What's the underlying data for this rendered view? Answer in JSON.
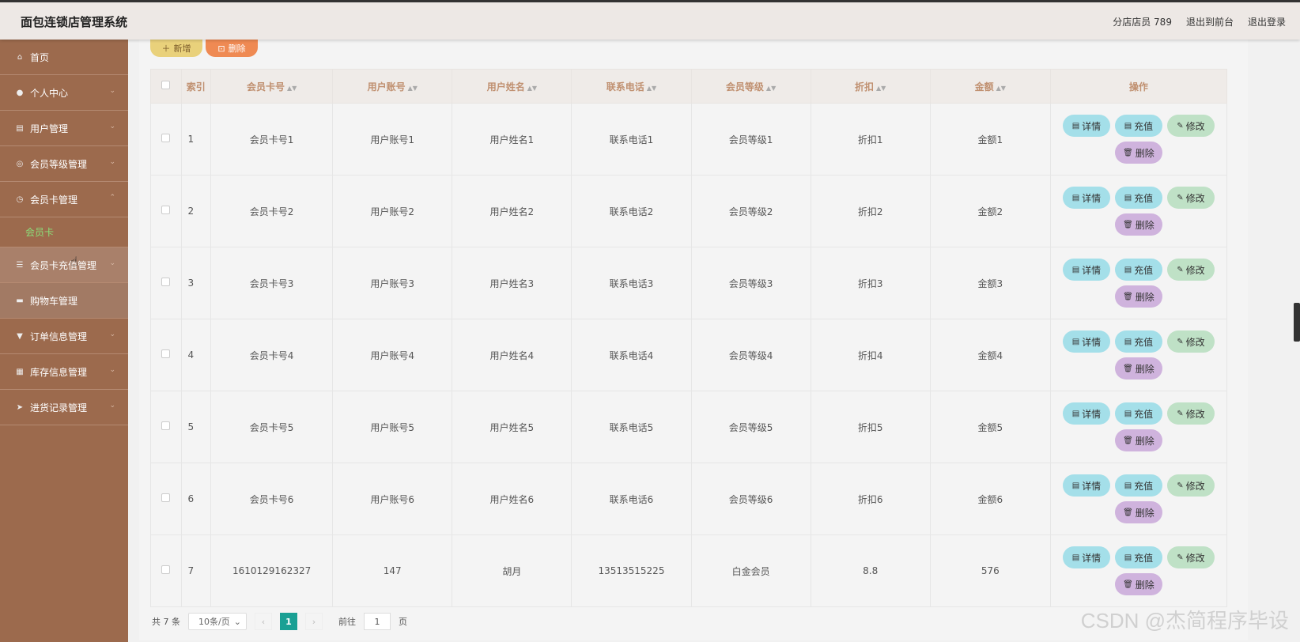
{
  "header": {
    "title": "面包连锁店管理系统",
    "user": "分店店员 789",
    "to_front": "退出到前台",
    "logout": "退出登录"
  },
  "sidebar": {
    "items": [
      {
        "label": "首页",
        "icon": "home-icon"
      },
      {
        "label": "个人中心",
        "icon": "user-icon"
      },
      {
        "label": "用户管理",
        "icon": "clipboard-icon"
      },
      {
        "label": "会员等级管理",
        "icon": "compass-icon"
      },
      {
        "label": "会员卡管理",
        "icon": "clock-icon"
      },
      {
        "label": "会员卡",
        "icon": ""
      },
      {
        "label": "会员卡充值管理",
        "icon": "list-icon"
      },
      {
        "label": "购物车管理",
        "icon": "cart-icon"
      },
      {
        "label": "订单信息管理",
        "icon": "filter-icon"
      },
      {
        "label": "库存信息管理",
        "icon": "printer-icon"
      },
      {
        "label": "进货记录管理",
        "icon": "send-icon"
      }
    ]
  },
  "toolbar": {
    "add_label": "新增",
    "delete_label": "删除"
  },
  "table": {
    "headers": [
      "索引",
      "会员卡号",
      "用户账号",
      "用户姓名",
      "联系电话",
      "会员等级",
      "折扣",
      "金额",
      "操作"
    ],
    "rows": [
      {
        "idx": "1",
        "card": "会员卡号1",
        "account": "用户账号1",
        "name": "用户姓名1",
        "phone": "联系电话1",
        "level": "会员等级1",
        "discount": "折扣1",
        "amount": "金额1"
      },
      {
        "idx": "2",
        "card": "会员卡号2",
        "account": "用户账号2",
        "name": "用户姓名2",
        "phone": "联系电话2",
        "level": "会员等级2",
        "discount": "折扣2",
        "amount": "金额2"
      },
      {
        "idx": "3",
        "card": "会员卡号3",
        "account": "用户账号3",
        "name": "用户姓名3",
        "phone": "联系电话3",
        "level": "会员等级3",
        "discount": "折扣3",
        "amount": "金额3"
      },
      {
        "idx": "4",
        "card": "会员卡号4",
        "account": "用户账号4",
        "name": "用户姓名4",
        "phone": "联系电话4",
        "level": "会员等级4",
        "discount": "折扣4",
        "amount": "金额4"
      },
      {
        "idx": "5",
        "card": "会员卡号5",
        "account": "用户账号5",
        "name": "用户姓名5",
        "phone": "联系电话5",
        "level": "会员等级5",
        "discount": "折扣5",
        "amount": "金额5"
      },
      {
        "idx": "6",
        "card": "会员卡号6",
        "account": "用户账号6",
        "name": "用户姓名6",
        "phone": "联系电话6",
        "level": "会员等级6",
        "discount": "折扣6",
        "amount": "金额6"
      },
      {
        "idx": "7",
        "card": "1610129162327",
        "account": "147",
        "name": "胡月",
        "phone": "13513515225",
        "level": "白金会员",
        "discount": "8.8",
        "amount": "576"
      }
    ],
    "actions": {
      "detail": "详情",
      "charge": "充值",
      "edit": "修改",
      "remove": "删除"
    }
  },
  "pagination": {
    "total": "共 7 条",
    "page_size": "10条/页",
    "current": "1",
    "goto_label": "前往",
    "goto_value": "1",
    "page_unit": "页"
  },
  "watermark": "CSDN @杰简程序毕设"
}
